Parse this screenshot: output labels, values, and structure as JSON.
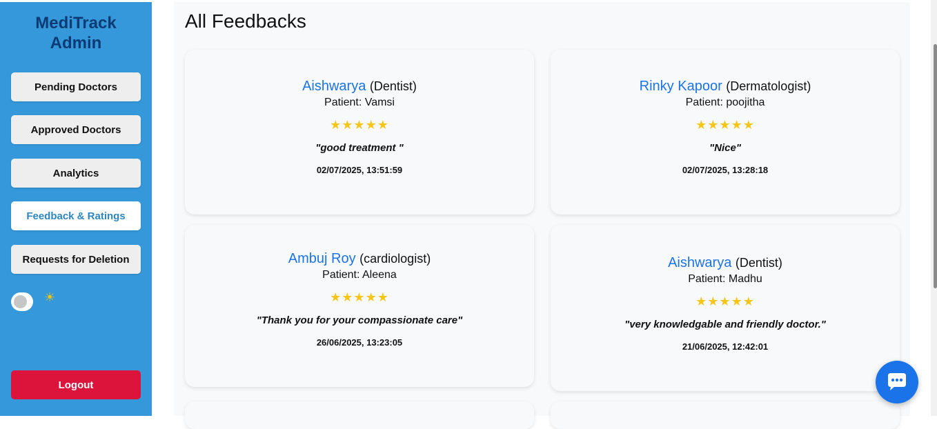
{
  "brand": {
    "line1": "MediTrack",
    "line2": "Admin"
  },
  "nav": {
    "pending": "Pending Doctors",
    "approved": "Approved Doctors",
    "analytics": "Analytics",
    "feedback": "Feedback & Ratings",
    "deletion": "Requests for Deletion"
  },
  "theme": {
    "icon": "☀",
    "mode_icon": "sun-icon",
    "toggle_on": false
  },
  "logout": "Logout",
  "page_title": "All Feedbacks",
  "feedbacks": [
    {
      "doctor": "Aishwarya",
      "specialty": "(Dentist)",
      "patient": "Patient: Vamsi",
      "rating": 5,
      "stars": "★★★★★",
      "comment": "\"good treatment \"",
      "date": "02/07/2025, 13:51:59"
    },
    {
      "doctor": "Rinky Kapoor",
      "specialty": "(Dermatologist)",
      "patient": "Patient: poojitha",
      "rating": 5,
      "stars": "★★★★★",
      "comment": "\"Nice\"",
      "date": "02/07/2025, 13:28:18"
    },
    {
      "doctor": "Ambuj Roy",
      "specialty": "(cardiologist)",
      "patient": "Patient: Aleena",
      "rating": 5,
      "stars": "★★★★★",
      "comment": "\"Thank you for your compassionate care\"",
      "date": "26/06/2025, 13:23:05"
    },
    {
      "doctor": "Aishwarya",
      "specialty": "(Dentist)",
      "patient": "Patient: Madhu",
      "rating": 5,
      "stars": "★★★★★",
      "comment": "\"very knowledgable and friendly doctor.\"",
      "date": "21/06/2025, 12:42:01"
    }
  ],
  "colors": {
    "sidebar": "#3498db",
    "brand": "#0b3b74",
    "logout": "#dc143c",
    "link": "#1a73e8",
    "star": "#f5c518"
  },
  "chat": {
    "icon": "chat-bubble-icon"
  }
}
